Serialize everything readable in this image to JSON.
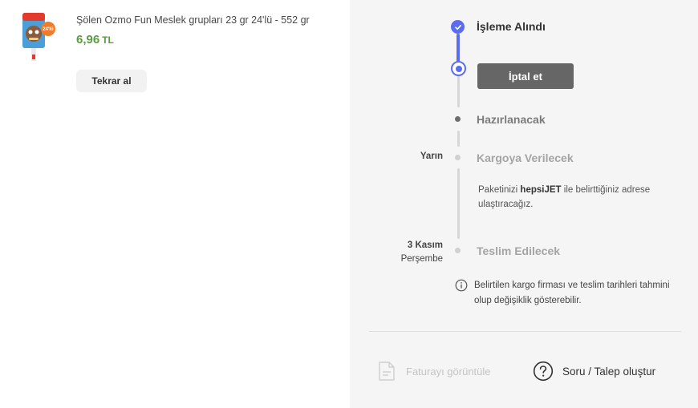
{
  "product": {
    "name": "Şölen Ozmo Fun Meslek grupları 23 gr 24'lü - 552 gr",
    "price": "6,96",
    "currency": "TL",
    "reorder_label": "Tekrar al",
    "image_icon": "product-thumbnail-icon",
    "badge_text": "24'lü"
  },
  "tracking": {
    "steps": [
      {
        "title": "İşleme Alındı",
        "state": "done"
      },
      {
        "title": "Hazırlanacak",
        "state": "next"
      },
      {
        "title": "Kargoya Verilecek",
        "state": "future",
        "date": "Yarın"
      },
      {
        "title": "Teslim Edilecek",
        "state": "future",
        "date_line1": "3 Kasım",
        "date_line2": "Perşembe"
      }
    ],
    "cancel_label": "İptal et",
    "carrier_text_before": "Paketinizi ",
    "carrier_name": "hepsiJET",
    "carrier_text_after": " ile belirttiğiniz adrese ulaştıracağız.",
    "notice": "Belirtilen kargo firması ve teslim tarihleri tahmini olup değişiklik gösterebilir."
  },
  "actions": {
    "invoice_label": "Faturayı görüntüle",
    "support_label": "Soru / Talep oluştur"
  },
  "colors": {
    "accent": "#5b6cf0",
    "price": "#5d9a43",
    "cancel_bg": "#666666",
    "panel_bg": "#f5f5f5"
  }
}
